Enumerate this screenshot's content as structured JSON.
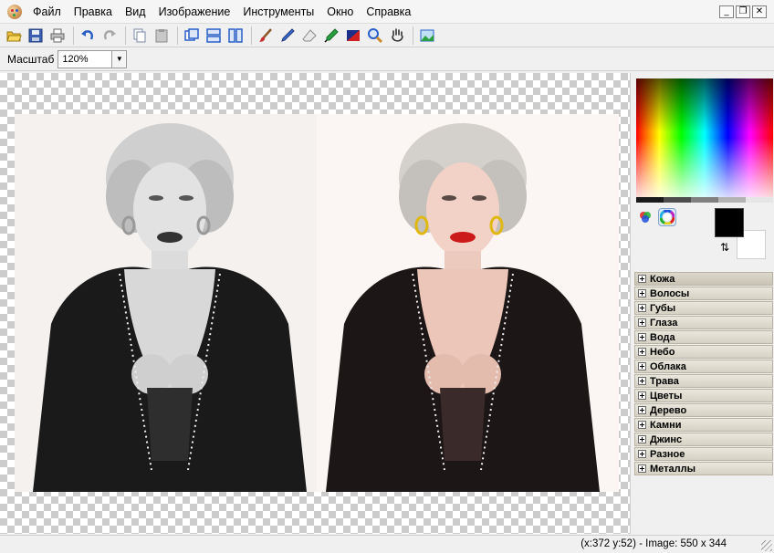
{
  "menu": {
    "items": [
      "Файл",
      "Правка",
      "Вид",
      "Изображение",
      "Инструменты",
      "Окно",
      "Справка"
    ]
  },
  "window_controls": {
    "minimize": "_",
    "restore": "❐",
    "close": "✕"
  },
  "toolbar": {
    "icons": [
      "open-icon",
      "save-icon",
      "print-icon",
      "undo-icon",
      "redo-icon",
      "copy-icon",
      "paste-icon",
      "view-single-icon",
      "view-horizontal-icon",
      "view-vertical-icon",
      "brush-icon",
      "pencil-icon",
      "eraser-icon",
      "eyedropper-icon",
      "fill-icon",
      "magnifier-icon",
      "hand-icon",
      "image-icon"
    ]
  },
  "zoom": {
    "label": "Масштаб",
    "value": "120%"
  },
  "color_panel": {
    "foreground": "#000000",
    "background": "#ffffff",
    "swap_glyph": "⇅",
    "grays": [
      "#1a1a1a",
      "#4d4d4d",
      "#808080",
      "#b3b3b3",
      "#e6e6e6"
    ]
  },
  "categories": [
    "Кожа",
    "Волосы",
    "Губы",
    "Глаза",
    "Вода",
    "Небо",
    "Облака",
    "Трава",
    "Цветы",
    "Дерево",
    "Камни",
    "Джинс",
    "Разное",
    "Металлы"
  ],
  "status": {
    "text": "(x:372 y:52) - Image: 550 x 344"
  }
}
